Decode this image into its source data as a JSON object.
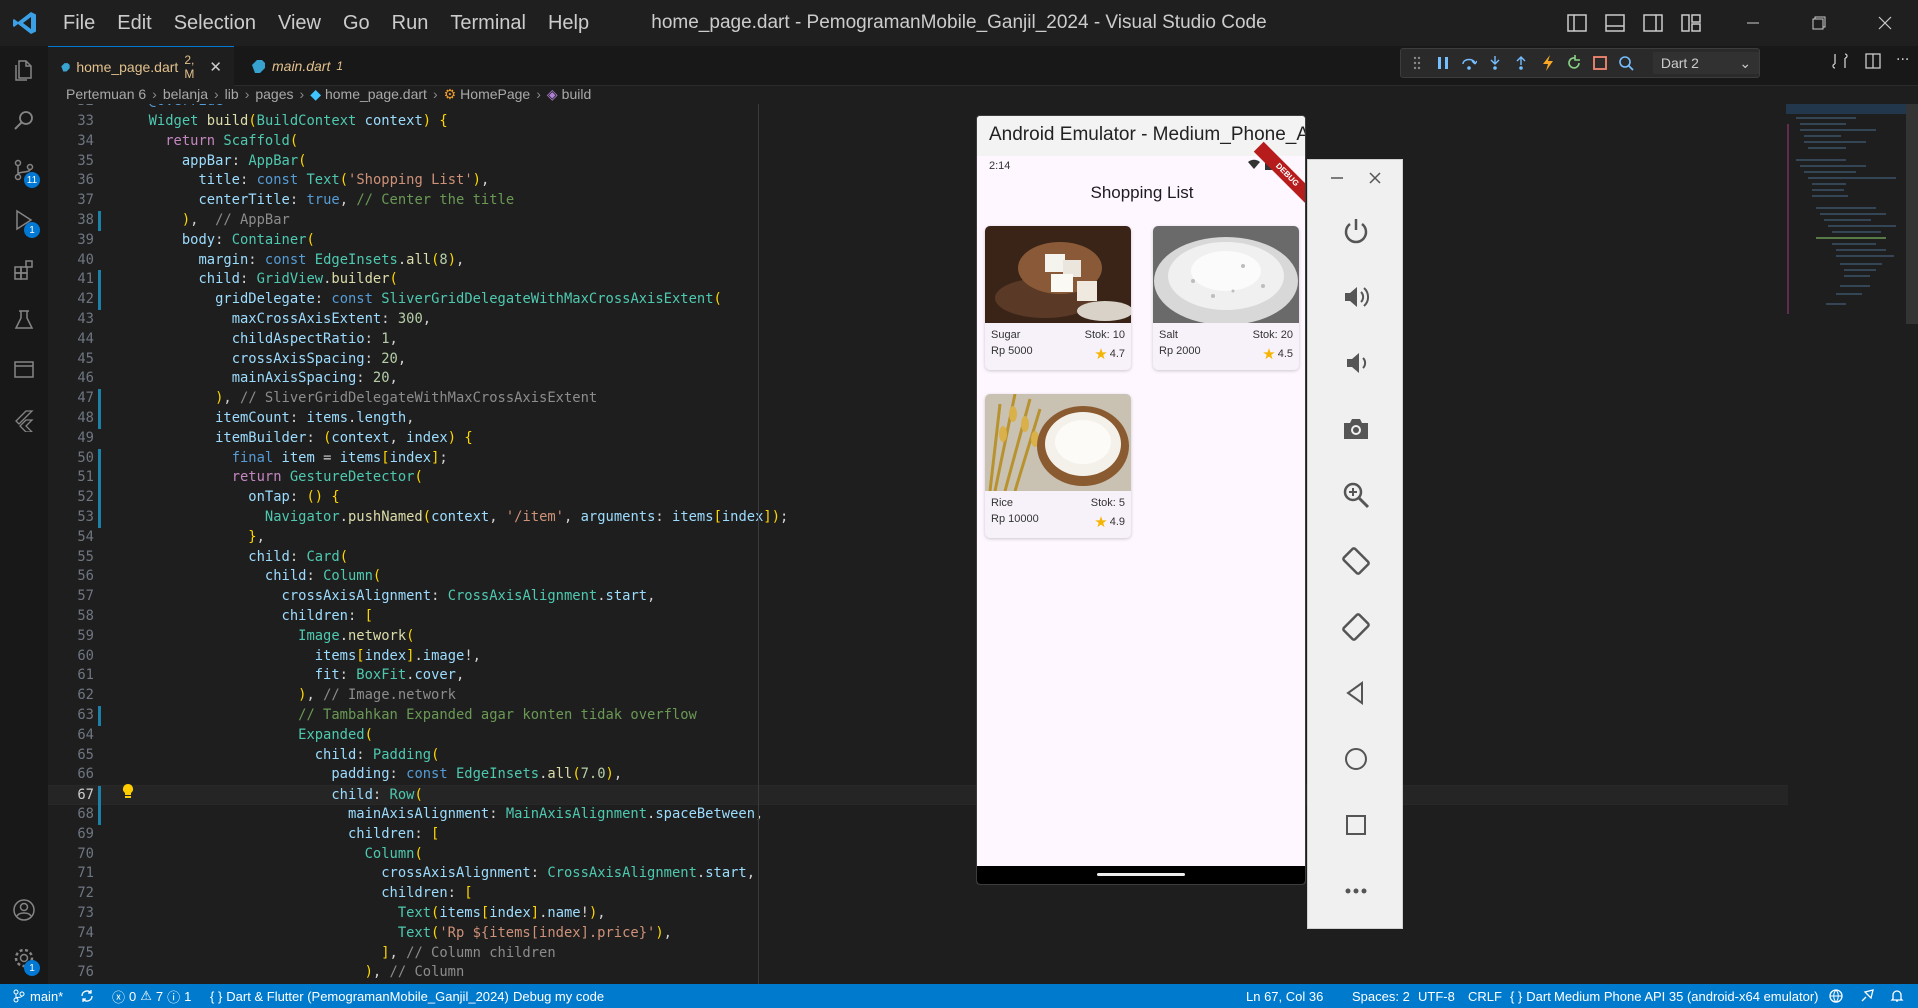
{
  "window": {
    "title": "home_page.dart - PemogramanMobile_Ganjil_2024 - Visual Studio Code"
  },
  "menu": [
    "File",
    "Edit",
    "Selection",
    "View",
    "Go",
    "Run",
    "Terminal",
    "Help"
  ],
  "activity_badges": {
    "source_control": "11",
    "run_debug": "1",
    "accounts": "1"
  },
  "tabs": [
    {
      "file": "home_page.dart",
      "status": "2, M",
      "active": true
    },
    {
      "file": "main.dart",
      "status": "1",
      "active": false
    }
  ],
  "debug": {
    "config": "Dart 2"
  },
  "breadcrumb": [
    "Pertemuan 6",
    "belanja",
    "lib",
    "pages",
    "home_page.dart",
    "HomePage",
    "build"
  ],
  "code": {
    "partial_top": "@override",
    "current_line": 67,
    "lines": [
      {
        "n": 33,
        "t": "Widget build(BuildContext context) {"
      },
      {
        "n": 34,
        "t": "  return Scaffold("
      },
      {
        "n": 35,
        "t": "    appBar: AppBar("
      },
      {
        "n": 36,
        "t": "      title: const Text('Shopping List'),"
      },
      {
        "n": 37,
        "t": "      centerTitle: true, // Center the title"
      },
      {
        "n": 38,
        "t": "    ),  // AppBar"
      },
      {
        "n": 39,
        "t": "    body: Container("
      },
      {
        "n": 40,
        "t": "      margin: const EdgeInsets.all(8),"
      },
      {
        "n": 41,
        "t": "      child: GridView.builder("
      },
      {
        "n": 42,
        "t": "        gridDelegate: const SliverGridDelegateWithMaxCrossAxisExtent("
      },
      {
        "n": 43,
        "t": "          maxCrossAxisExtent: 300,"
      },
      {
        "n": 44,
        "t": "          childAspectRatio: 1,"
      },
      {
        "n": 45,
        "t": "          crossAxisSpacing: 20,"
      },
      {
        "n": 46,
        "t": "          mainAxisSpacing: 20,"
      },
      {
        "n": 47,
        "t": "        ), // SliverGridDelegateWithMaxCrossAxisExtent"
      },
      {
        "n": 48,
        "t": "        itemCount: items.length,"
      },
      {
        "n": 49,
        "t": "        itemBuilder: (context, index) {"
      },
      {
        "n": 50,
        "t": "          final item = items[index];"
      },
      {
        "n": 51,
        "t": "          return GestureDetector("
      },
      {
        "n": 52,
        "t": "            onTap: () {"
      },
      {
        "n": 53,
        "t": "              Navigator.pushNamed(context, '/item', arguments: items[index]);"
      },
      {
        "n": 54,
        "t": "            },"
      },
      {
        "n": 55,
        "t": "            child: Card("
      },
      {
        "n": 56,
        "t": "              child: Column("
      },
      {
        "n": 57,
        "t": "                crossAxisAlignment: CrossAxisAlignment.start,"
      },
      {
        "n": 58,
        "t": "                children: ["
      },
      {
        "n": 59,
        "t": "                  Image.network("
      },
      {
        "n": 60,
        "t": "                    items[index].image!,"
      },
      {
        "n": 61,
        "t": "                    fit: BoxFit.cover,"
      },
      {
        "n": 62,
        "t": "                  ), // Image.network"
      },
      {
        "n": 63,
        "t": "                  // Tambahkan Expanded agar konten tidak overflow"
      },
      {
        "n": 64,
        "t": "                  Expanded("
      },
      {
        "n": 65,
        "t": "                    child: Padding("
      },
      {
        "n": 66,
        "t": "                      padding: const EdgeInsets.all(7.0),"
      },
      {
        "n": 67,
        "t": "                      child: Row("
      },
      {
        "n": 68,
        "t": "                        mainAxisAlignment: MainAxisAlignment.spaceBetween,"
      },
      {
        "n": 69,
        "t": "                        children: ["
      },
      {
        "n": 70,
        "t": "                          Column("
      },
      {
        "n": 71,
        "t": "                            crossAxisAlignment: CrossAxisAlignment.start,"
      },
      {
        "n": 72,
        "t": "                            children: ["
      },
      {
        "n": 73,
        "t": "                              Text(items[index].name!),"
      },
      {
        "n": 74,
        "t": "                              Text('Rp ${items[index].price}'),"
      },
      {
        "n": 75,
        "t": "                            ], // Column children"
      },
      {
        "n": 76,
        "t": "                          ), // Column"
      }
    ]
  },
  "emulator": {
    "title": "Android Emulator - Medium_Phone_A...",
    "time": "2:14",
    "debug_banner": "DEBUG",
    "app_title": "Shopping List",
    "items": [
      {
        "name": "Sugar",
        "price": "Rp 5000",
        "stock": "Stok: 10",
        "rating": "4.7"
      },
      {
        "name": "Salt",
        "price": "Rp 2000",
        "stock": "Stok: 20",
        "rating": "4.5"
      },
      {
        "name": "Rice",
        "price": "Rp 10000",
        "stock": "Stok: 5",
        "rating": "4.9"
      }
    ],
    "tools": [
      "power-icon",
      "volume-up-icon",
      "volume-down-icon",
      "camera-icon",
      "zoom-icon",
      "rotate-left-icon",
      "rotate-right-icon",
      "back-icon",
      "home-icon",
      "overview-icon",
      "more-icon"
    ]
  },
  "statusbar": {
    "branch": "main*",
    "problems": "0",
    "warnings": "7",
    "infos": "1",
    "sdk": "Dart & Flutter (PemogramanMobile_Ganjil_2024)",
    "debug_mode": "Debug my code",
    "position": "Ln 67, Col 36",
    "spaces": "Spaces: 2",
    "encoding": "UTF-8",
    "eol": "CRLF",
    "language": "Dart",
    "device": "Medium Phone API 35 (android-x64 emulator)"
  },
  "colors": {
    "accent": "#0078d4",
    "statusbar": "#007acc",
    "editor_bg": "#1e1e1e",
    "rating_star": "#f5b400"
  }
}
